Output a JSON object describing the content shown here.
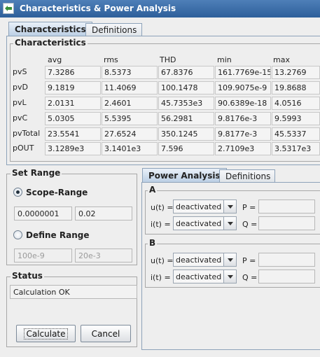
{
  "window": {
    "title": "Characteristics & Power Analysis"
  },
  "top_tabs": [
    "Characteristics",
    "Definitions"
  ],
  "characteristics": {
    "group_title": "Characteristics",
    "columns": [
      "avg",
      "rms",
      "THD",
      "min",
      "max"
    ],
    "rows": [
      {
        "label": "pvS",
        "values": [
          "7.3286",
          "8.5373",
          "67.8376",
          "161.7769e-15",
          "13.2769"
        ]
      },
      {
        "label": "pvD",
        "values": [
          "9.1819",
          "11.4069",
          "100.1478",
          "109.9075e-9",
          "19.8688"
        ]
      },
      {
        "label": "pvL",
        "values": [
          "2.0131",
          "2.4601",
          "45.7353e3",
          "90.6389e-18",
          "4.0516"
        ]
      },
      {
        "label": "pvC",
        "values": [
          "5.0305",
          "5.5395",
          "56.2981",
          "9.8176e-3",
          "9.5993"
        ]
      },
      {
        "label": "pvTotal",
        "values": [
          "23.5541",
          "27.6524",
          "350.1245",
          "9.8177e-3",
          "45.5337"
        ]
      },
      {
        "label": "pOUT",
        "values": [
          "3.1289e3",
          "3.1401e3",
          "7.596",
          "2.7109e3",
          "3.5317e3"
        ]
      }
    ]
  },
  "set_range": {
    "title": "Set Range",
    "scope_label": "Scope-Range",
    "scope_from": "0.0000001",
    "scope_to": "0.02",
    "define_label": "Define Range",
    "define_from": "100e-9",
    "define_to": "20e-3",
    "selected": "scope"
  },
  "status": {
    "title": "Status",
    "text": "Calculation OK"
  },
  "buttons": {
    "calculate": "Calculate",
    "cancel": "Cancel"
  },
  "power_tabs": [
    "Power Analysis",
    "Definitions"
  ],
  "power": {
    "A": {
      "title": "A",
      "u_label": "u(t) =",
      "u_value": "deactivated",
      "i_label": "i(t) =",
      "i_value": "deactivated",
      "p_label": "P =",
      "q_label": "Q =",
      "p_value": "",
      "q_value": ""
    },
    "B": {
      "title": "B",
      "u_label": "u(t) =",
      "u_value": "deactivated",
      "i_label": "i(t) =",
      "i_value": "deactivated",
      "p_label": "P =",
      "q_label": "Q =",
      "p_value": "",
      "q_value": ""
    }
  },
  "colors": {
    "titlebar": "#2d5f9a",
    "selected_tab": "#b9cde3"
  },
  "icons": [
    "app-icon",
    "chevron-down-icon"
  ]
}
